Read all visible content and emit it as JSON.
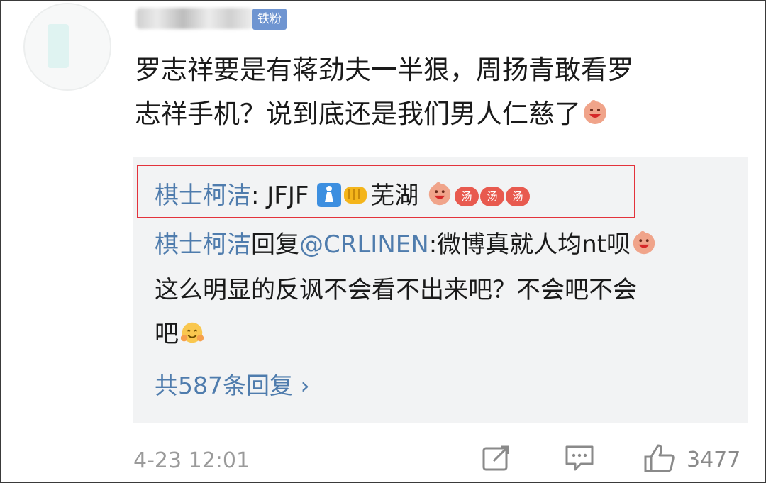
{
  "author": {
    "badge": "铁粉"
  },
  "comment": {
    "line1": "罗志祥要是有蒋劲夫一半狠，周扬青敢看罗",
    "line2": "志祥手机？说到底还是我们男人仁慈了"
  },
  "highlight_reply": {
    "name": "棋士柯洁",
    "text": ": JFJF",
    "location": "芜湖"
  },
  "reply": {
    "name": "棋士柯洁",
    "text_a": "回复",
    "mention": "@CRLINEN",
    "text_b": ":微博真就人均nt呗",
    "line2": "这么明显的反讽不会看不出来吧？不会吧不会",
    "line3": "吧"
  },
  "more_replies": "共587条回复 ›",
  "footer": {
    "time": "4-23 12:01",
    "likes": "3477"
  },
  "emoji_labels": {
    "pill": "汤"
  },
  "icons": [
    "laugh-emoji-icon",
    "restroom-woman-icon",
    "fist-icon",
    "hug-emoji-icon",
    "share-icon",
    "comment-icon",
    "like-icon"
  ]
}
